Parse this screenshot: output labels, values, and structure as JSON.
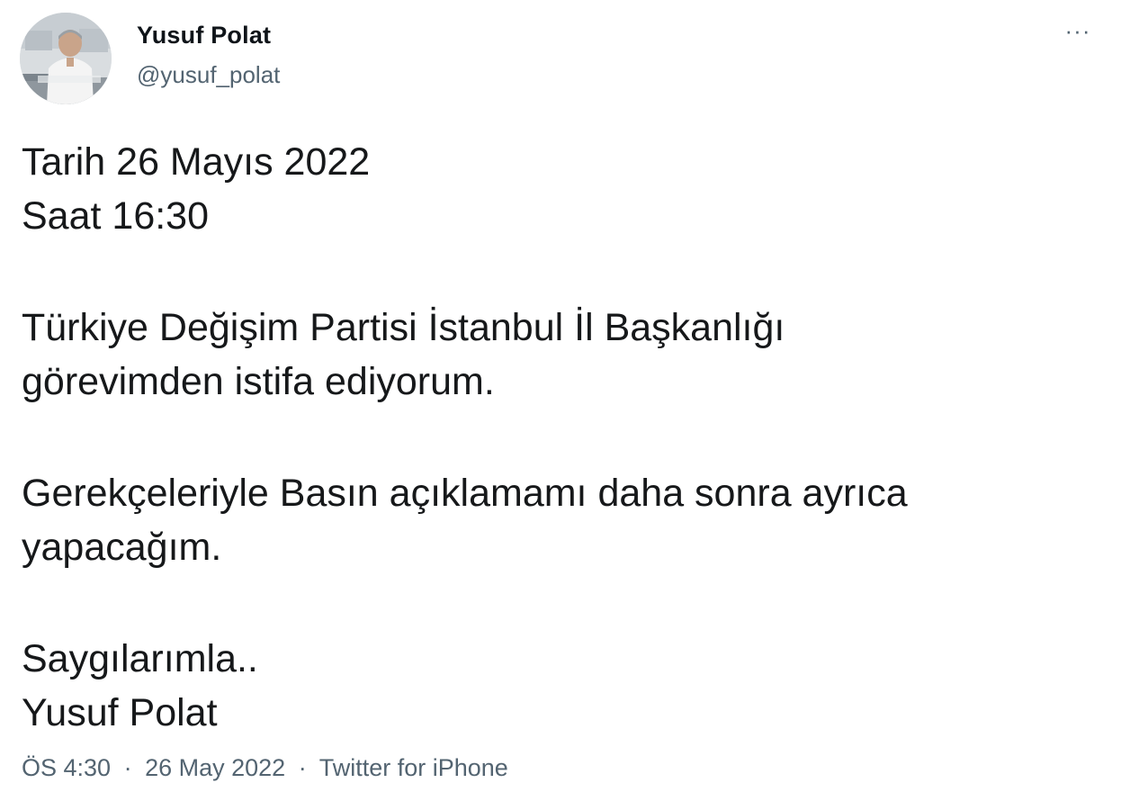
{
  "author": {
    "name": "Yusuf Polat",
    "handle": "@yusuf_polat",
    "avatar_icon": "profile-photo"
  },
  "more_icon": "more-horizontal-icon",
  "more_label": "···",
  "tweet_text": {
    "p1_line1": "Tarih 26 Mayıs 2022",
    "p1_line2": "Saat 16:30",
    "p2_line1": "Türkiye Değişim Partisi İstanbul İl Başkanlığı",
    "p2_line2": "görevimden istifa ediyorum.",
    "p3_line1": "Gerekçeleriyle Basın açıklamamı daha sonra ayrıca",
    "p3_line2": "yapacağım.",
    "p4_line1": "Saygılarımla..",
    "p4_line2": "Yusuf Polat"
  },
  "meta": {
    "time": "ÖS 4:30",
    "separator": "·",
    "date": "26 May 2022",
    "source": "Twitter for iPhone"
  },
  "colors": {
    "text_primary": "#0f1419",
    "text_secondary": "#536471",
    "background": "#ffffff"
  }
}
